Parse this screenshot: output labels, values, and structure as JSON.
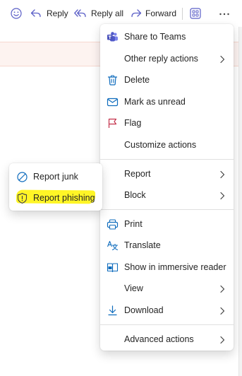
{
  "toolbar": {
    "emoji_icon": "emoji-icon",
    "reply_label": "Reply",
    "reply_all_label": "Reply all",
    "forward_label": "Forward",
    "apps_icon": "apps-grid-icon",
    "more_icon": "more-horizontal-icon"
  },
  "menu": {
    "items": [
      {
        "label": "Share to Teams",
        "icon": "teams-icon"
      },
      {
        "label": "Other reply actions",
        "icon": "",
        "submenu": true
      },
      {
        "label": "Delete",
        "icon": "trash-icon"
      },
      {
        "label": "Mark as unread",
        "icon": "mail-icon"
      },
      {
        "label": "Flag",
        "icon": "flag-icon"
      },
      {
        "label": "Customize actions",
        "icon": ""
      },
      {
        "label": "Report",
        "icon": "",
        "submenu": true
      },
      {
        "label": "Block",
        "icon": "",
        "submenu": true
      },
      {
        "label": "Print",
        "icon": "print-icon"
      },
      {
        "label": "Translate",
        "icon": "translate-icon"
      },
      {
        "label": "Show in immersive reader",
        "icon": "immersive-reader-icon"
      },
      {
        "label": "View",
        "icon": "",
        "submenu": true
      },
      {
        "label": "Download",
        "icon": "download-icon",
        "submenu": true
      },
      {
        "label": "Advanced actions",
        "icon": "",
        "submenu": true
      }
    ]
  },
  "submenu": {
    "items": [
      {
        "label": "Report junk",
        "icon": "block-icon"
      },
      {
        "label": "Report phishing",
        "icon": "shield-warning-icon"
      }
    ],
    "highlight_color": "#fff300"
  },
  "colors": {
    "accent": "#5b5fc7",
    "flag": "#c4314b",
    "icon_blue": "#0f6cbd",
    "banner": "#fdf3f0"
  }
}
